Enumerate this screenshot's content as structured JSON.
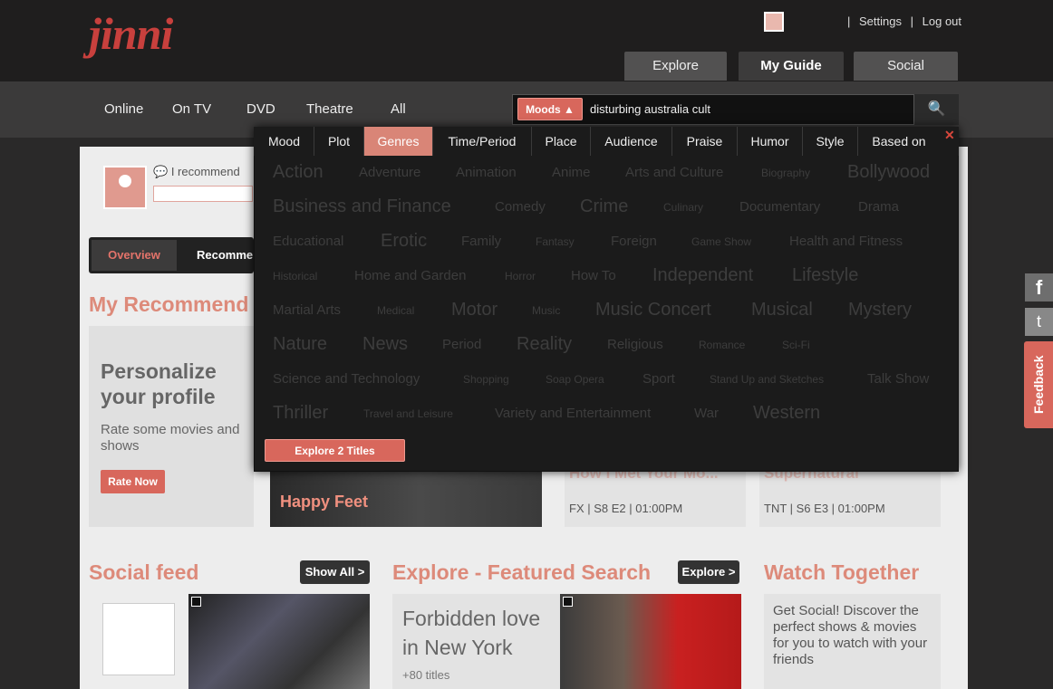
{
  "header": {
    "logo": "jinni",
    "links": [
      "Settings",
      "Log out"
    ],
    "tabs": [
      {
        "label": "Explore",
        "active": false
      },
      {
        "label": "My Guide",
        "active": true
      },
      {
        "label": "Social",
        "active": false
      }
    ]
  },
  "nav": {
    "items": [
      "Online",
      "On TV",
      "DVD",
      "Theatre",
      "All"
    ]
  },
  "search": {
    "mode_label": "Moods ▲",
    "query": "disturbing australia cult",
    "button_icon": "search-icon"
  },
  "dropdown": {
    "tabs": [
      {
        "label": "Mood",
        "active": false
      },
      {
        "label": "Plot",
        "active": false
      },
      {
        "label": "Genres",
        "active": true
      },
      {
        "label": "Time/Period",
        "active": false
      },
      {
        "label": "Place",
        "active": false
      },
      {
        "label": "Audience",
        "active": false
      },
      {
        "label": "Praise",
        "active": false
      },
      {
        "label": "Humor",
        "active": false
      },
      {
        "label": "Style",
        "active": false
      },
      {
        "label": "Based on",
        "active": false
      }
    ],
    "close_icon": "close-icon",
    "genres": [
      "Action",
      "Adventure",
      "Animation",
      "Anime",
      "Arts and Culture",
      "Biography",
      "Bollywood",
      "Business and Finance",
      "Comedy",
      "Crime",
      "Culinary",
      "Documentary",
      "Drama",
      "Educational",
      "Erotic",
      "Family",
      "Fantasy",
      "Foreign",
      "Game Show",
      "Health and Fitness",
      "Historical",
      "Home and Garden",
      "Horror",
      "How To",
      "Independent",
      "Lifestyle",
      "Martial Arts",
      "Medical",
      "Motor",
      "Music",
      "Music Concert",
      "Musical",
      "Mystery",
      "Nature",
      "News",
      "Period",
      "Reality",
      "Religious",
      "Romance",
      "Sci-Fi",
      "Science and Technology",
      "Shopping",
      "Soap Opera",
      "Sport",
      "Stand Up and Sketches",
      "Talk Show",
      "Thriller",
      "Travel and Leisure",
      "Variety and Entertainment",
      "War",
      "Western"
    ],
    "explore_button": "Explore 2 Titles"
  },
  "profile": {
    "recommend_label": "I recommend"
  },
  "guide_tabs": {
    "overview": "Overview",
    "recommend": "Recomme"
  },
  "my_recommendations": {
    "title": "My Recommend",
    "personalize_title": "Personalize your profile",
    "personalize_text": "Rate some movies and shows",
    "rate_button": "Rate Now",
    "cards": [
      {
        "title": "Happy Feet"
      },
      {
        "title": "How I Met Your Mo...",
        "time": "FX | S8 E2 | 01:00PM"
      },
      {
        "title": "Supernatural",
        "time": "TNT | S6 E3 | 01:00PM"
      }
    ]
  },
  "social_feed": {
    "title": "Social feed",
    "button": "Show All >"
  },
  "featured": {
    "title": "Explore - Featured Search",
    "button": "Explore >",
    "card_title": "Forbidden love in New York",
    "card_count": "+80 titles"
  },
  "watch_together": {
    "title": "Watch Together",
    "text": "Get Social! Discover the perfect shows & movies for you to watch with your friends"
  },
  "side": {
    "facebook": "f",
    "twitter": "t",
    "feedback": "Feedback"
  }
}
